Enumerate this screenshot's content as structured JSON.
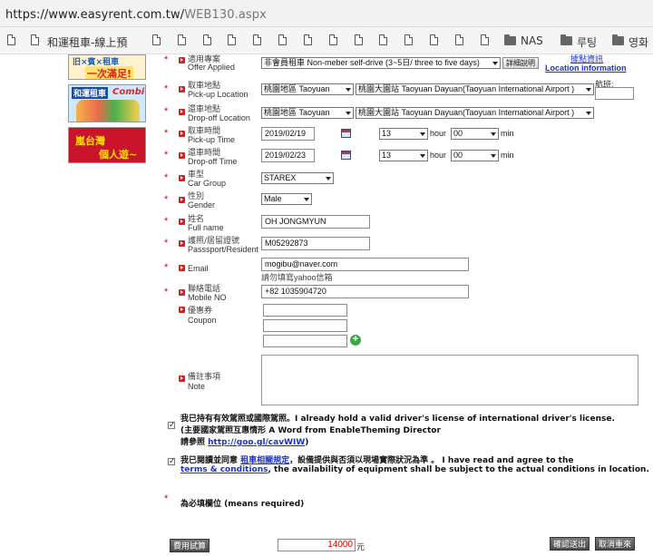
{
  "browser": {
    "url_main": "https://www.easyrent.com.tw/",
    "url_path": "WEB130.aspx"
  },
  "bookmarks": [
    "和運租車-線上預",
    "NAS",
    "루팅",
    "영화"
  ],
  "banners": {
    "b1_line1": "旧×賓×租車",
    "b1_line2": "一次滿足!",
    "b2_line1": "和運租車",
    "b2_line2": "Combi",
    "b3_line1": "嵐台灣",
    "b3_line2": "個人遊~"
  },
  "form": {
    "offer": {
      "zh": "適用專案",
      "en": "Offer Applied",
      "value": "非會員租車 Non-meber self-drive (3~5日/ three to five days)",
      "details_button": "詳細說明",
      "info_zh": "據點資訊",
      "info_link": "Location information"
    },
    "pickup_location": {
      "zh": "取車地點",
      "en": "Pick-up Location",
      "region": "桃園地區 Taoyuan",
      "station": "桃園大園站 Taoyuan Dayuan(Taoyuan International Airport )",
      "flight_label": "航班:"
    },
    "dropoff_location": {
      "zh": "還車地點",
      "en": "Drop-off Location",
      "region": "桃園地區 Taoyuan",
      "station": "桃園大園站 Taoyuan Dayuan(Taoyuan International Airport )"
    },
    "pickup_time": {
      "zh": "取車時間",
      "en": "Pick-up Time",
      "date": "2019/02/19",
      "hour": "13",
      "hour_label": "hour",
      "min": "00",
      "min_label": "min"
    },
    "dropoff_time": {
      "zh": "還車時間",
      "en": "Drop-off Time",
      "date": "2019/02/23",
      "hour": "13",
      "hour_label": "hour",
      "min": "00",
      "min_label": "min"
    },
    "car_group": {
      "zh": "車型",
      "en": "Car Group",
      "value": "STAREX"
    },
    "gender": {
      "zh": "性別",
      "en": "Gender",
      "value": "Male"
    },
    "full_name": {
      "zh": "姓名",
      "en": "Full name",
      "value": "OH JONGMYUN"
    },
    "passport": {
      "zh": "護照/居留證號",
      "en": "Passsport/Resident",
      "value": "M05292873"
    },
    "email": {
      "en": "Email",
      "value": "mogibu@naver.com",
      "hint": "請勿填寫yahoo信箱"
    },
    "mobile": {
      "zh": "聯絡電話",
      "en": "Mobile NO",
      "value": "+82 1035904720"
    },
    "coupon": {
      "zh": "優惠券",
      "en": "Coupon",
      "add": "+"
    },
    "note": {
      "zh": "備註事項",
      "en": "Note"
    }
  },
  "agreements": {
    "license_line1": "我已持有有效駕照或國際駕照。I already hold a valid driver's license of international driver's license.",
    "license_line2": "(主要國家駕照互惠情形 A Word from EnableTheming Director",
    "license_line3_pre": "請參照 ",
    "license_link": "http://goo.gl/cavWIW",
    "license_line3_post": ")",
    "terms_line1_pre": "我已閱讀並同意 ",
    "terms_link_zh": "租車相關規定",
    "terms_line1_post": "，設備提供與否須以現場實際狀況為準 。 I have read and agree to the",
    "terms_link_en": "terms & conditions",
    "terms_line2_post": ", the availability of equipment shall be subject to the actual conditions in location."
  },
  "required_note": "為必填欄位 (means required)",
  "footer": {
    "estimate_button": "費用試算",
    "price": "14000",
    "currency": "元",
    "submit_button": "確認送出",
    "cancel_button": "取消重來"
  },
  "colors": {
    "required_star": "#dd0000",
    "link": "#1a33cc",
    "price": "#dd0000"
  }
}
